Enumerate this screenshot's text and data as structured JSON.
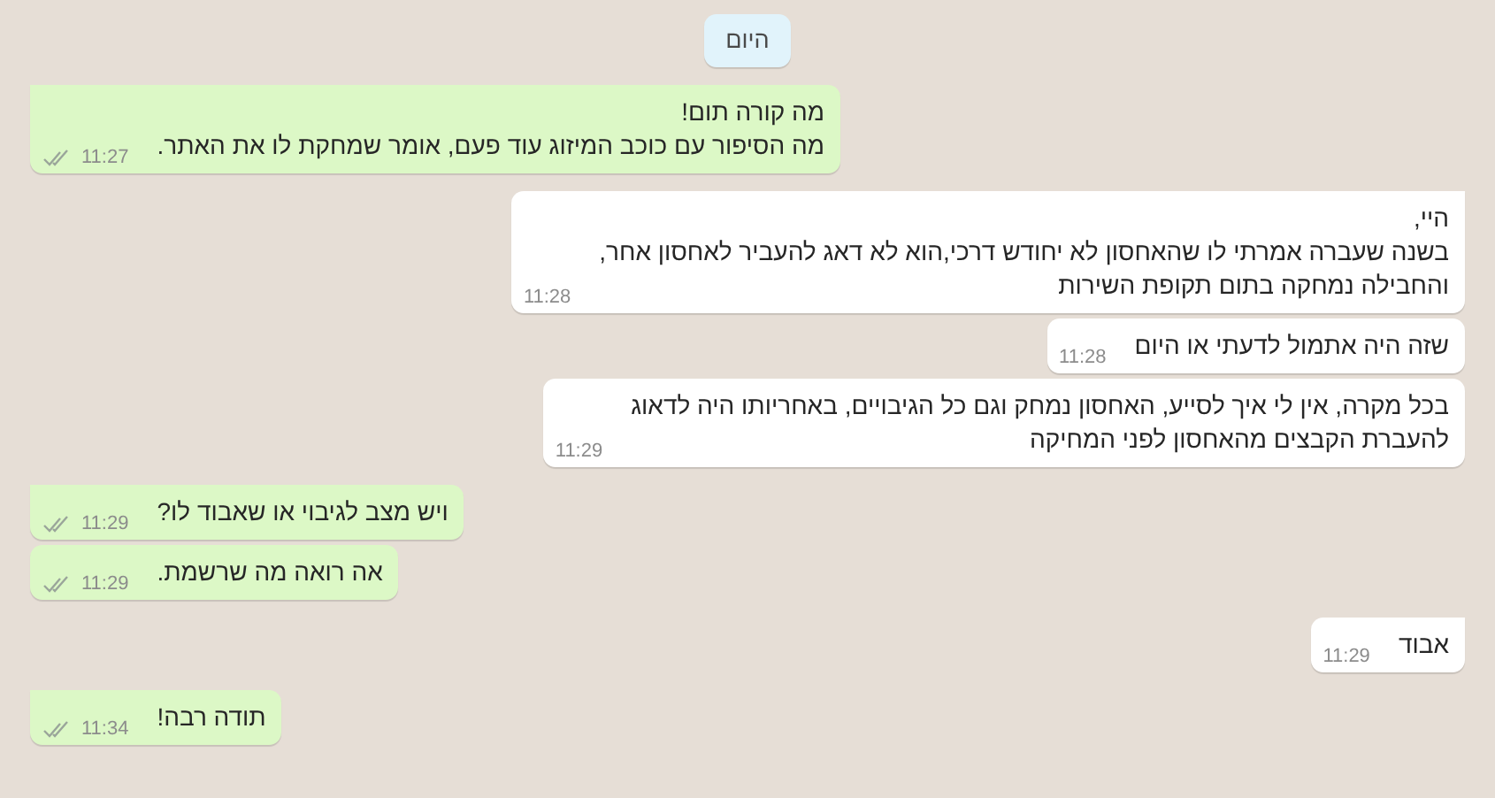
{
  "date_chip": "היום",
  "messages": [
    {
      "kind": "out",
      "tail": true,
      "lines": [
        "מה קורה תום!",
        "מה הסיפור עם כוכב המיזוג עוד פעם, אומר שמחקת לו את האתר."
      ],
      "time": "11:27"
    },
    {
      "kind": "in",
      "tail": true,
      "lines": [
        "היי,",
        "בשנה שעברה אמרתי לו שהאחסון לא יחודש דרכי,הוא לא דאג להעביר לאחסון אחר,",
        "והחבילה נמחקה בתום תקופת השירות"
      ],
      "time": "11:28"
    },
    {
      "kind": "in",
      "tail": false,
      "lines": [
        "שזה היה אתמול לדעתי או היום"
      ],
      "time": "11:28"
    },
    {
      "kind": "in",
      "tail": false,
      "lines": [
        "בכל מקרה, אין לי איך לסייע, האחסון נמחק וגם כל הגיבויים, באחריותו היה לדאוג",
        "להעברת הקבצים מהאחסון לפני המחיקה"
      ],
      "time": "11:29"
    },
    {
      "kind": "out",
      "tail": true,
      "lines": [
        "ויש מצב לגיבוי או שאבוד לו?"
      ],
      "time": "11:29"
    },
    {
      "kind": "out",
      "tail": false,
      "lines": [
        "אה רואה מה שרשמת."
      ],
      "time": "11:29"
    },
    {
      "kind": "in",
      "tail": true,
      "lines": [
        "אבוד"
      ],
      "time": "11:29"
    },
    {
      "kind": "out",
      "tail": true,
      "lines": [
        "תודה רבה!"
      ],
      "time": "11:34"
    }
  ]
}
